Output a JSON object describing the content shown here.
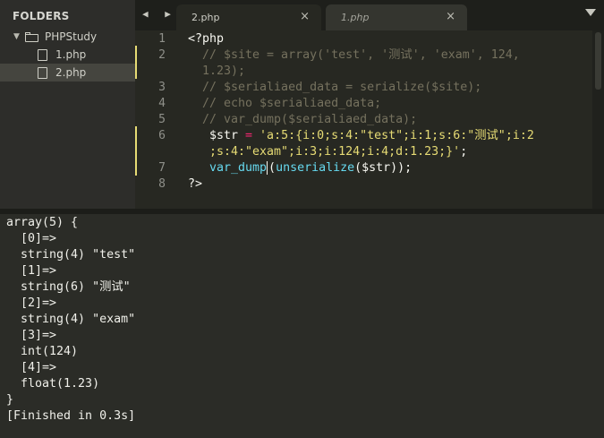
{
  "sidebar": {
    "header": "FOLDERS",
    "folder": {
      "arrow": "▼",
      "name": "PHPStudy"
    },
    "files": [
      {
        "name": "1.php",
        "selected": false
      },
      {
        "name": "2.php",
        "selected": true
      }
    ]
  },
  "tabbar": {
    "nav_arrows": "◀ ▶",
    "tabs": [
      {
        "label": "2.php",
        "close": "×",
        "active": true
      },
      {
        "label": "1.php",
        "close": "×",
        "active": false
      }
    ],
    "dropdown_icon": "chevron-down-icon"
  },
  "editor": {
    "gutter": [
      "1",
      "2",
      "",
      "3",
      "4",
      "5",
      "6",
      "",
      "7",
      "8"
    ],
    "lines": [
      {
        "tokens": [
          {
            "t": "<?php",
            "c": "tag"
          }
        ]
      },
      {
        "tokens": [
          {
            "t": "// $site = array('test', '测试', 'exam', 124,",
            "c": "comment"
          }
        ]
      },
      {
        "tokens": [
          {
            "t": "1.23);",
            "c": "comment"
          }
        ]
      },
      {
        "tokens": [
          {
            "t": "// $serialiaed_data = serialize($site);",
            "c": "comment"
          }
        ]
      },
      {
        "tokens": [
          {
            "t": "// echo $serialiaed_data;",
            "c": "comment"
          }
        ]
      },
      {
        "tokens": [
          {
            "t": "// var_dump($serialiaed_data);",
            "c": "comment"
          }
        ]
      },
      {
        "tokens": [
          {
            "t": "$str ",
            "c": "var"
          },
          {
            "t": "=",
            "c": "op"
          },
          {
            "t": " 'a:5:{i:0;s:4:\"test\";i:1;s:6:\"测试\";i:2",
            "c": "str"
          }
        ]
      },
      {
        "tokens": [
          {
            "t": ";s:4:\"exam\";i:3;i:124;i:4;d:1.23;}'",
            "c": "str"
          },
          {
            "t": ";",
            "c": "var"
          }
        ]
      },
      {
        "tokens": [
          {
            "t": "var_dump",
            "c": "func"
          },
          {
            "t": "CURSOR",
            "c": "cursor"
          },
          {
            "t": "(",
            "c": "var"
          },
          {
            "t": "unserialize",
            "c": "func"
          },
          {
            "t": "($str));",
            "c": "var"
          }
        ]
      },
      {
        "tokens": [
          {
            "t": "?>",
            "c": "tag"
          }
        ]
      }
    ],
    "colors": {
      "background": "#272822",
      "comment": "#75715e",
      "string": "#e6db74",
      "function": "#66d9ef",
      "operator": "#f92672"
    }
  },
  "output": {
    "lines": [
      "array(5) {",
      "  [0]=>",
      "  string(4) \"test\"",
      "  [1]=>",
      "  string(6) \"测试\"",
      "  [2]=>",
      "  string(4) \"exam\"",
      "  [3]=>",
      "  int(124)",
      "  [4]=>",
      "  float(1.23)",
      "}",
      "[Finished in 0.3s]"
    ]
  }
}
